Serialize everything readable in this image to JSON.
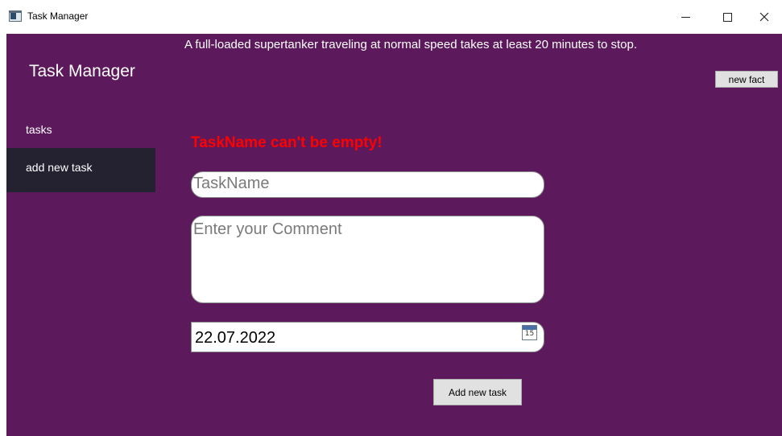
{
  "window": {
    "title": "Task Manager",
    "controls": {
      "minimize": "–",
      "maximize": "☐",
      "close": "✕"
    }
  },
  "sidebar": {
    "brand": "Task Manager",
    "items": [
      {
        "label": "tasks",
        "selected": false
      },
      {
        "label": "add new task",
        "selected": true
      }
    ]
  },
  "header": {
    "fact": "A full-loaded supertanker traveling at normal speed takes at least 20 minutes to stop.",
    "new_fact_label": "new fact"
  },
  "form": {
    "error": "TaskName can't be empty!",
    "taskname_placeholder": "TaskName",
    "comment_placeholder": "Enter your Comment",
    "date_value": "22.07.2022",
    "calendar_icon_number": "15",
    "submit_label": "Add new task"
  },
  "colors": {
    "background": "#5c1a5c",
    "selected_nav": "#242230",
    "error": "#ff0000"
  }
}
